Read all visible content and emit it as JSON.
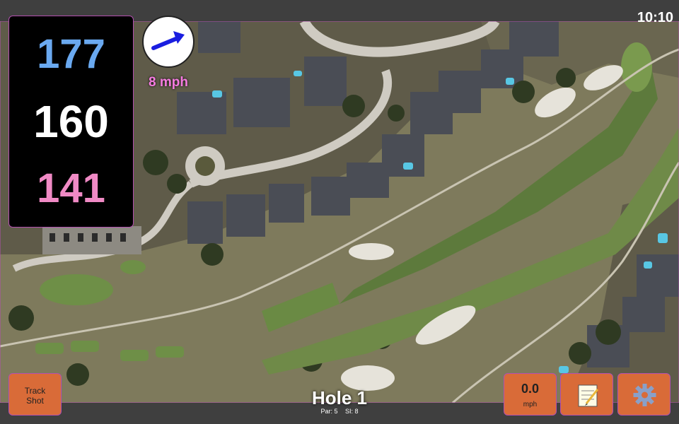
{
  "status_bar": {
    "time": "10:10"
  },
  "yardage": {
    "back": "177",
    "center": "160",
    "front": "141"
  },
  "wind": {
    "speed_label": "8 mph",
    "direction_icon": "wind-arrow-icon"
  },
  "buttons": {
    "track_shot_line1": "Track",
    "track_shot_line2": "Shot",
    "speed_value": "0.0",
    "speed_unit": "mph",
    "notes_icon": "notepad-icon",
    "settings_icon": "gear-icon"
  },
  "hole": {
    "title": "Hole 1",
    "par": "Par: 5",
    "si": "SI: 8"
  },
  "colors": {
    "back": "#6aa9f0",
    "center": "#ffffff",
    "front": "#f08ac5",
    "button": "#d96b38",
    "wind_text": "#f57be0"
  }
}
